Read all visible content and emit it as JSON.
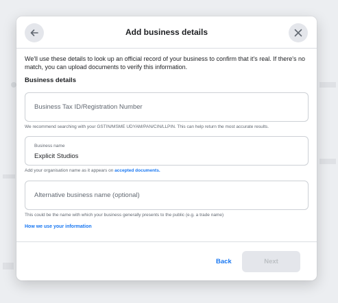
{
  "dialog": {
    "title": "Add business details",
    "intro": "We'll use these details to look up an official record of your business to confirm that it's real. If there's no match, you can upload documents to verify this information.",
    "section_title": "Business details"
  },
  "fields": {
    "tax_id": {
      "placeholder": "Business Tax ID/Registration Number",
      "help": "We recommend searching with your GSTIN/MSME UDYAM/PAN/CIN/LLPIN. This can help return the most accurate results."
    },
    "business_name": {
      "label": "Business name",
      "value": "Explicit Studios",
      "help_prefix": "Add your organisation name as it appears on",
      "help_link": "accepted documents."
    },
    "alt_name": {
      "placeholder": "Alternative business name (optional)",
      "help": "This could be the name with which your business generally presents to the public (e.g. a trade name)"
    }
  },
  "links": {
    "how_we_use": "How we use your information"
  },
  "footer": {
    "back_label": "Back",
    "next_label": "Next"
  },
  "icons": {
    "back": "arrow-left-icon",
    "close": "close-icon"
  },
  "colors": {
    "accent": "#1877f2",
    "disabled_bg": "#e4e6eb"
  }
}
